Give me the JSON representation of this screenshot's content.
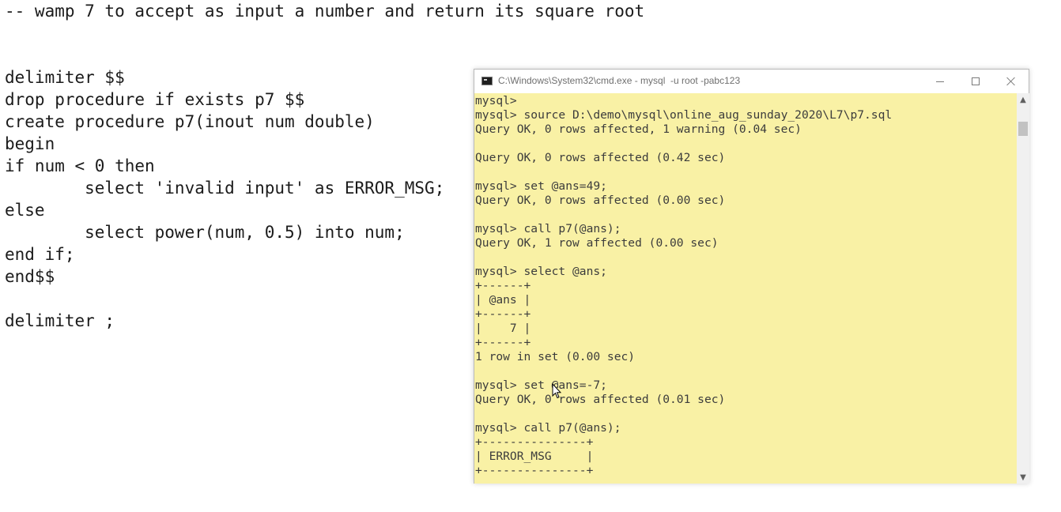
{
  "editor": {
    "lines": [
      "-- wamp 7 to accept as input a number and return its square root",
      "delimiter $$",
      "drop procedure if exists p7 $$",
      "create procedure p7(inout num double)",
      "begin",
      "if num < 0 then",
      "        select 'invalid input' as ERROR_MSG;",
      "else",
      "        select power(num, 0.5) into num;",
      "end if;",
      "end$$",
      "delimiter ;"
    ]
  },
  "console": {
    "title": "C:\\Windows\\System32\\cmd.exe - mysql  -u root -pabc123",
    "lines": [
      "mysql>",
      "mysql> source D:\\demo\\mysql\\online_aug_sunday_2020\\L7\\p7.sql",
      "Query OK, 0 rows affected, 1 warning (0.04 sec)",
      "",
      "Query OK, 0 rows affected (0.42 sec)",
      "",
      "mysql> set @ans=49;",
      "Query OK, 0 rows affected (0.00 sec)",
      "",
      "mysql> call p7(@ans);",
      "Query OK, 1 row affected (0.00 sec)",
      "",
      "mysql> select @ans;",
      "+------+",
      "| @ans |",
      "+------+",
      "|    7 |",
      "+------+",
      "1 row in set (0.00 sec)",
      "",
      "mysql> set @ans=-7;",
      "Query OK, 0 rows affected (0.01 sec)",
      "",
      "mysql> call p7(@ans);",
      "+---------------+",
      "| ERROR_MSG     |",
      "+---------------+"
    ],
    "background_color": "#f9f1a5"
  },
  "icons": {
    "title_icon": "cmd-icon",
    "minimize": "minimize-icon",
    "maximize": "maximize-icon",
    "close": "close-icon",
    "scroll_up": "chevron-up-icon",
    "scroll_down": "chevron-down-icon",
    "cursor": "mouse-cursor-icon"
  }
}
